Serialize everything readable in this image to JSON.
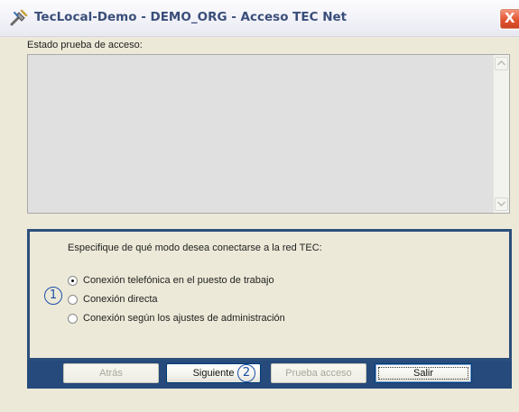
{
  "window": {
    "title": "TecLocal-Demo - DEMO_ORG - Acceso TEC Net",
    "icon": "app-tools-icon",
    "close_label": "X"
  },
  "status": {
    "label": "Estado prueba de acceso:",
    "content": ""
  },
  "connection": {
    "question": "Especifique de qué modo desea conectarse a la red TEC:",
    "options": [
      {
        "label": "Conexión telefónica en el puesto de trabajo",
        "checked": true
      },
      {
        "label": "Conexión directa",
        "checked": false
      },
      {
        "label": "Conexión según los ajustes de administración",
        "checked": false
      }
    ]
  },
  "markers": {
    "one": "1",
    "two": "2"
  },
  "buttons": {
    "back": "Atrás",
    "next": "Siguiente",
    "test": "Prueba acceso",
    "exit": "Salir"
  },
  "colors": {
    "title_text": "#3a4e79",
    "panel_border": "#2c4f7c",
    "marker": "#1d4fa8",
    "close_button": "#e2542f"
  }
}
